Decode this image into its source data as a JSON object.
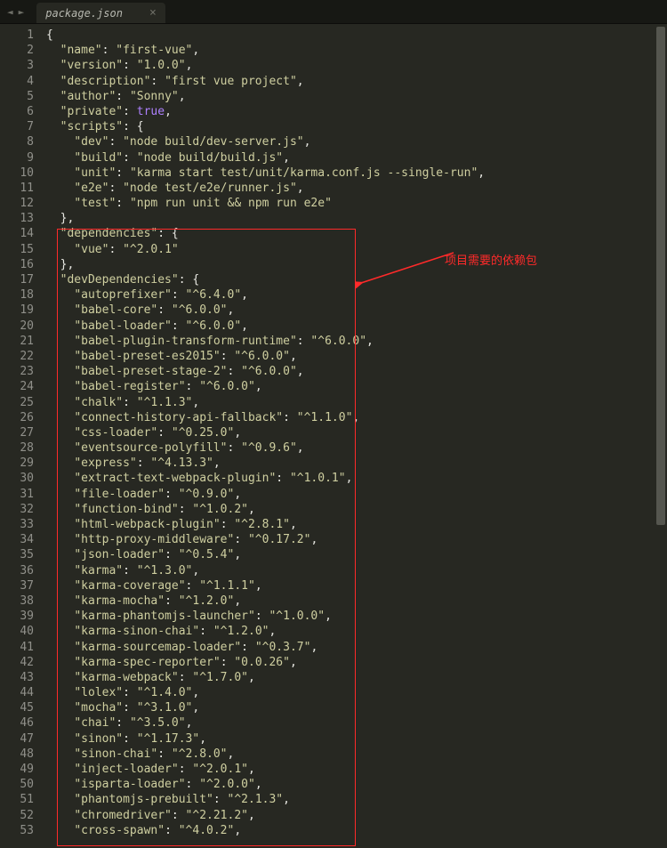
{
  "tab": {
    "title": "package.json",
    "close": "×"
  },
  "nav": {
    "back": "◄",
    "forward": "►"
  },
  "annotation": {
    "label": "项目需要的依赖包"
  },
  "lines": [
    {
      "n": 1,
      "indent": 0,
      "tokens": [
        {
          "t": "{",
          "c": "brace"
        }
      ]
    },
    {
      "n": 2,
      "indent": 1,
      "tokens": [
        {
          "t": "\"name\"",
          "c": "str"
        },
        {
          "t": ": ",
          "c": "colon"
        },
        {
          "t": "\"first-vue\"",
          "c": "str"
        },
        {
          "t": ",",
          "c": "brace"
        }
      ]
    },
    {
      "n": 3,
      "indent": 1,
      "tokens": [
        {
          "t": "\"version\"",
          "c": "str"
        },
        {
          "t": ": ",
          "c": "colon"
        },
        {
          "t": "\"1.0.0\"",
          "c": "str"
        },
        {
          "t": ",",
          "c": "brace"
        }
      ]
    },
    {
      "n": 4,
      "indent": 1,
      "tokens": [
        {
          "t": "\"description\"",
          "c": "str"
        },
        {
          "t": ": ",
          "c": "colon"
        },
        {
          "t": "\"first vue project\"",
          "c": "str"
        },
        {
          "t": ",",
          "c": "brace"
        }
      ]
    },
    {
      "n": 5,
      "indent": 1,
      "tokens": [
        {
          "t": "\"author\"",
          "c": "str"
        },
        {
          "t": ": ",
          "c": "colon"
        },
        {
          "t": "\"Sonny\"",
          "c": "str"
        },
        {
          "t": ",",
          "c": "brace"
        }
      ]
    },
    {
      "n": 6,
      "indent": 1,
      "tokens": [
        {
          "t": "\"private\"",
          "c": "str"
        },
        {
          "t": ": ",
          "c": "colon"
        },
        {
          "t": "true",
          "c": "kw"
        },
        {
          "t": ",",
          "c": "brace"
        }
      ]
    },
    {
      "n": 7,
      "indent": 1,
      "tokens": [
        {
          "t": "\"scripts\"",
          "c": "str"
        },
        {
          "t": ": {",
          "c": "brace"
        }
      ]
    },
    {
      "n": 8,
      "indent": 2,
      "tokens": [
        {
          "t": "\"dev\"",
          "c": "str"
        },
        {
          "t": ": ",
          "c": "colon"
        },
        {
          "t": "\"node build/dev-server.js\"",
          "c": "str"
        },
        {
          "t": ",",
          "c": "brace"
        }
      ]
    },
    {
      "n": 9,
      "indent": 2,
      "tokens": [
        {
          "t": "\"build\"",
          "c": "str"
        },
        {
          "t": ": ",
          "c": "colon"
        },
        {
          "t": "\"node build/build.js\"",
          "c": "str"
        },
        {
          "t": ",",
          "c": "brace"
        }
      ]
    },
    {
      "n": 10,
      "indent": 2,
      "tokens": [
        {
          "t": "\"unit\"",
          "c": "str"
        },
        {
          "t": ": ",
          "c": "colon"
        },
        {
          "t": "\"karma start test/unit/karma.conf.js --single-run\"",
          "c": "str"
        },
        {
          "t": ",",
          "c": "brace"
        }
      ]
    },
    {
      "n": 11,
      "indent": 2,
      "tokens": [
        {
          "t": "\"e2e\"",
          "c": "str"
        },
        {
          "t": ": ",
          "c": "colon"
        },
        {
          "t": "\"node test/e2e/runner.js\"",
          "c": "str"
        },
        {
          "t": ",",
          "c": "brace"
        }
      ]
    },
    {
      "n": 12,
      "indent": 2,
      "tokens": [
        {
          "t": "\"test\"",
          "c": "str"
        },
        {
          "t": ": ",
          "c": "colon"
        },
        {
          "t": "\"npm run unit && npm run e2e\"",
          "c": "str"
        }
      ]
    },
    {
      "n": 13,
      "indent": 1,
      "tokens": [
        {
          "t": "},",
          "c": "brace"
        }
      ]
    },
    {
      "n": 14,
      "indent": 1,
      "tokens": [
        {
          "t": "\"dependencies\"",
          "c": "str"
        },
        {
          "t": ": {",
          "c": "brace"
        }
      ]
    },
    {
      "n": 15,
      "indent": 2,
      "tokens": [
        {
          "t": "\"vue\"",
          "c": "str"
        },
        {
          "t": ": ",
          "c": "colon"
        },
        {
          "t": "\"^2.0.1\"",
          "c": "str"
        }
      ]
    },
    {
      "n": 16,
      "indent": 1,
      "tokens": [
        {
          "t": "},",
          "c": "brace"
        }
      ]
    },
    {
      "n": 17,
      "indent": 1,
      "tokens": [
        {
          "t": "\"devDependencies\"",
          "c": "str"
        },
        {
          "t": ": {",
          "c": "brace"
        }
      ]
    },
    {
      "n": 18,
      "indent": 2,
      "tokens": [
        {
          "t": "\"autoprefixer\"",
          "c": "str"
        },
        {
          "t": ": ",
          "c": "colon"
        },
        {
          "t": "\"^6.4.0\"",
          "c": "str"
        },
        {
          "t": ",",
          "c": "brace"
        }
      ]
    },
    {
      "n": 19,
      "indent": 2,
      "tokens": [
        {
          "t": "\"babel-core\"",
          "c": "str"
        },
        {
          "t": ": ",
          "c": "colon"
        },
        {
          "t": "\"^6.0.0\"",
          "c": "str"
        },
        {
          "t": ",",
          "c": "brace"
        }
      ]
    },
    {
      "n": 20,
      "indent": 2,
      "tokens": [
        {
          "t": "\"babel-loader\"",
          "c": "str"
        },
        {
          "t": ": ",
          "c": "colon"
        },
        {
          "t": "\"^6.0.0\"",
          "c": "str"
        },
        {
          "t": ",",
          "c": "brace"
        }
      ]
    },
    {
      "n": 21,
      "indent": 2,
      "tokens": [
        {
          "t": "\"babel-plugin-transform-runtime\"",
          "c": "str"
        },
        {
          "t": ": ",
          "c": "colon"
        },
        {
          "t": "\"^6.0.0\"",
          "c": "str"
        },
        {
          "t": ",",
          "c": "brace"
        }
      ]
    },
    {
      "n": 22,
      "indent": 2,
      "tokens": [
        {
          "t": "\"babel-preset-es2015\"",
          "c": "str"
        },
        {
          "t": ": ",
          "c": "colon"
        },
        {
          "t": "\"^6.0.0\"",
          "c": "str"
        },
        {
          "t": ",",
          "c": "brace"
        }
      ]
    },
    {
      "n": 23,
      "indent": 2,
      "tokens": [
        {
          "t": "\"babel-preset-stage-2\"",
          "c": "str"
        },
        {
          "t": ": ",
          "c": "colon"
        },
        {
          "t": "\"^6.0.0\"",
          "c": "str"
        },
        {
          "t": ",",
          "c": "brace"
        }
      ]
    },
    {
      "n": 24,
      "indent": 2,
      "tokens": [
        {
          "t": "\"babel-register\"",
          "c": "str"
        },
        {
          "t": ": ",
          "c": "colon"
        },
        {
          "t": "\"^6.0.0\"",
          "c": "str"
        },
        {
          "t": ",",
          "c": "brace"
        }
      ]
    },
    {
      "n": 25,
      "indent": 2,
      "tokens": [
        {
          "t": "\"chalk\"",
          "c": "str"
        },
        {
          "t": ": ",
          "c": "colon"
        },
        {
          "t": "\"^1.1.3\"",
          "c": "str"
        },
        {
          "t": ",",
          "c": "brace"
        }
      ]
    },
    {
      "n": 26,
      "indent": 2,
      "tokens": [
        {
          "t": "\"connect-history-api-fallback\"",
          "c": "str"
        },
        {
          "t": ": ",
          "c": "colon"
        },
        {
          "t": "\"^1.1.0\"",
          "c": "str"
        },
        {
          "t": ",",
          "c": "brace"
        }
      ]
    },
    {
      "n": 27,
      "indent": 2,
      "tokens": [
        {
          "t": "\"css-loader\"",
          "c": "str"
        },
        {
          "t": ": ",
          "c": "colon"
        },
        {
          "t": "\"^0.25.0\"",
          "c": "str"
        },
        {
          "t": ",",
          "c": "brace"
        }
      ]
    },
    {
      "n": 28,
      "indent": 2,
      "tokens": [
        {
          "t": "\"eventsource-polyfill\"",
          "c": "str"
        },
        {
          "t": ": ",
          "c": "colon"
        },
        {
          "t": "\"^0.9.6\"",
          "c": "str"
        },
        {
          "t": ",",
          "c": "brace"
        }
      ]
    },
    {
      "n": 29,
      "indent": 2,
      "tokens": [
        {
          "t": "\"express\"",
          "c": "str"
        },
        {
          "t": ": ",
          "c": "colon"
        },
        {
          "t": "\"^4.13.3\"",
          "c": "str"
        },
        {
          "t": ",",
          "c": "brace"
        }
      ]
    },
    {
      "n": 30,
      "indent": 2,
      "tokens": [
        {
          "t": "\"extract-text-webpack-plugin\"",
          "c": "str"
        },
        {
          "t": ": ",
          "c": "colon"
        },
        {
          "t": "\"^1.0.1\"",
          "c": "str"
        },
        {
          "t": ",",
          "c": "brace"
        }
      ]
    },
    {
      "n": 31,
      "indent": 2,
      "tokens": [
        {
          "t": "\"file-loader\"",
          "c": "str"
        },
        {
          "t": ": ",
          "c": "colon"
        },
        {
          "t": "\"^0.9.0\"",
          "c": "str"
        },
        {
          "t": ",",
          "c": "brace"
        }
      ]
    },
    {
      "n": 32,
      "indent": 2,
      "tokens": [
        {
          "t": "\"function-bind\"",
          "c": "str"
        },
        {
          "t": ": ",
          "c": "colon"
        },
        {
          "t": "\"^1.0.2\"",
          "c": "str"
        },
        {
          "t": ",",
          "c": "brace"
        }
      ]
    },
    {
      "n": 33,
      "indent": 2,
      "tokens": [
        {
          "t": "\"html-webpack-plugin\"",
          "c": "str"
        },
        {
          "t": ": ",
          "c": "colon"
        },
        {
          "t": "\"^2.8.1\"",
          "c": "str"
        },
        {
          "t": ",",
          "c": "brace"
        }
      ]
    },
    {
      "n": 34,
      "indent": 2,
      "tokens": [
        {
          "t": "\"http-proxy-middleware\"",
          "c": "str"
        },
        {
          "t": ": ",
          "c": "colon"
        },
        {
          "t": "\"^0.17.2\"",
          "c": "str"
        },
        {
          "t": ",",
          "c": "brace"
        }
      ]
    },
    {
      "n": 35,
      "indent": 2,
      "tokens": [
        {
          "t": "\"json-loader\"",
          "c": "str"
        },
        {
          "t": ": ",
          "c": "colon"
        },
        {
          "t": "\"^0.5.4\"",
          "c": "str"
        },
        {
          "t": ",",
          "c": "brace"
        }
      ]
    },
    {
      "n": 36,
      "indent": 2,
      "tokens": [
        {
          "t": "\"karma\"",
          "c": "str"
        },
        {
          "t": ": ",
          "c": "colon"
        },
        {
          "t": "\"^1.3.0\"",
          "c": "str"
        },
        {
          "t": ",",
          "c": "brace"
        }
      ]
    },
    {
      "n": 37,
      "indent": 2,
      "tokens": [
        {
          "t": "\"karma-coverage\"",
          "c": "str"
        },
        {
          "t": ": ",
          "c": "colon"
        },
        {
          "t": "\"^1.1.1\"",
          "c": "str"
        },
        {
          "t": ",",
          "c": "brace"
        }
      ]
    },
    {
      "n": 38,
      "indent": 2,
      "tokens": [
        {
          "t": "\"karma-mocha\"",
          "c": "str"
        },
        {
          "t": ": ",
          "c": "colon"
        },
        {
          "t": "\"^1.2.0\"",
          "c": "str"
        },
        {
          "t": ",",
          "c": "brace"
        }
      ]
    },
    {
      "n": 39,
      "indent": 2,
      "tokens": [
        {
          "t": "\"karma-phantomjs-launcher\"",
          "c": "str"
        },
        {
          "t": ": ",
          "c": "colon"
        },
        {
          "t": "\"^1.0.0\"",
          "c": "str"
        },
        {
          "t": ",",
          "c": "brace"
        }
      ]
    },
    {
      "n": 40,
      "indent": 2,
      "tokens": [
        {
          "t": "\"karma-sinon-chai\"",
          "c": "str"
        },
        {
          "t": ": ",
          "c": "colon"
        },
        {
          "t": "\"^1.2.0\"",
          "c": "str"
        },
        {
          "t": ",",
          "c": "brace"
        }
      ]
    },
    {
      "n": 41,
      "indent": 2,
      "tokens": [
        {
          "t": "\"karma-sourcemap-loader\"",
          "c": "str"
        },
        {
          "t": ": ",
          "c": "colon"
        },
        {
          "t": "\"^0.3.7\"",
          "c": "str"
        },
        {
          "t": ",",
          "c": "brace"
        }
      ]
    },
    {
      "n": 42,
      "indent": 2,
      "tokens": [
        {
          "t": "\"karma-spec-reporter\"",
          "c": "str"
        },
        {
          "t": ": ",
          "c": "colon"
        },
        {
          "t": "\"0.0.26\"",
          "c": "str"
        },
        {
          "t": ",",
          "c": "brace"
        }
      ]
    },
    {
      "n": 43,
      "indent": 2,
      "tokens": [
        {
          "t": "\"karma-webpack\"",
          "c": "str"
        },
        {
          "t": ": ",
          "c": "colon"
        },
        {
          "t": "\"^1.7.0\"",
          "c": "str"
        },
        {
          "t": ",",
          "c": "brace"
        }
      ]
    },
    {
      "n": 44,
      "indent": 2,
      "tokens": [
        {
          "t": "\"lolex\"",
          "c": "str"
        },
        {
          "t": ": ",
          "c": "colon"
        },
        {
          "t": "\"^1.4.0\"",
          "c": "str"
        },
        {
          "t": ",",
          "c": "brace"
        }
      ]
    },
    {
      "n": 45,
      "indent": 2,
      "tokens": [
        {
          "t": "\"mocha\"",
          "c": "str"
        },
        {
          "t": ": ",
          "c": "colon"
        },
        {
          "t": "\"^3.1.0\"",
          "c": "str"
        },
        {
          "t": ",",
          "c": "brace"
        }
      ]
    },
    {
      "n": 46,
      "indent": 2,
      "tokens": [
        {
          "t": "\"chai\"",
          "c": "str"
        },
        {
          "t": ": ",
          "c": "colon"
        },
        {
          "t": "\"^3.5.0\"",
          "c": "str"
        },
        {
          "t": ",",
          "c": "brace"
        }
      ]
    },
    {
      "n": 47,
      "indent": 2,
      "tokens": [
        {
          "t": "\"sinon\"",
          "c": "str"
        },
        {
          "t": ": ",
          "c": "colon"
        },
        {
          "t": "\"^1.17.3\"",
          "c": "str"
        },
        {
          "t": ",",
          "c": "brace"
        }
      ]
    },
    {
      "n": 48,
      "indent": 2,
      "tokens": [
        {
          "t": "\"sinon-chai\"",
          "c": "str"
        },
        {
          "t": ": ",
          "c": "colon"
        },
        {
          "t": "\"^2.8.0\"",
          "c": "str"
        },
        {
          "t": ",",
          "c": "brace"
        }
      ]
    },
    {
      "n": 49,
      "indent": 2,
      "tokens": [
        {
          "t": "\"inject-loader\"",
          "c": "str"
        },
        {
          "t": ": ",
          "c": "colon"
        },
        {
          "t": "\"^2.0.1\"",
          "c": "str"
        },
        {
          "t": ",",
          "c": "brace"
        }
      ]
    },
    {
      "n": 50,
      "indent": 2,
      "tokens": [
        {
          "t": "\"isparta-loader\"",
          "c": "str"
        },
        {
          "t": ": ",
          "c": "colon"
        },
        {
          "t": "\"^2.0.0\"",
          "c": "str"
        },
        {
          "t": ",",
          "c": "brace"
        }
      ]
    },
    {
      "n": 51,
      "indent": 2,
      "tokens": [
        {
          "t": "\"phantomjs-prebuilt\"",
          "c": "str"
        },
        {
          "t": ": ",
          "c": "colon"
        },
        {
          "t": "\"^2.1.3\"",
          "c": "str"
        },
        {
          "t": ",",
          "c": "brace"
        }
      ]
    },
    {
      "n": 52,
      "indent": 2,
      "tokens": [
        {
          "t": "\"chromedriver\"",
          "c": "str"
        },
        {
          "t": ": ",
          "c": "colon"
        },
        {
          "t": "\"^2.21.2\"",
          "c": "str"
        },
        {
          "t": ",",
          "c": "brace"
        }
      ]
    },
    {
      "n": 53,
      "indent": 2,
      "tokens": [
        {
          "t": "\"cross-spawn\"",
          "c": "str"
        },
        {
          "t": ": ",
          "c": "colon"
        },
        {
          "t": "\"^4.0.2\"",
          "c": "str"
        },
        {
          "t": ",",
          "c": "brace"
        }
      ]
    }
  ]
}
